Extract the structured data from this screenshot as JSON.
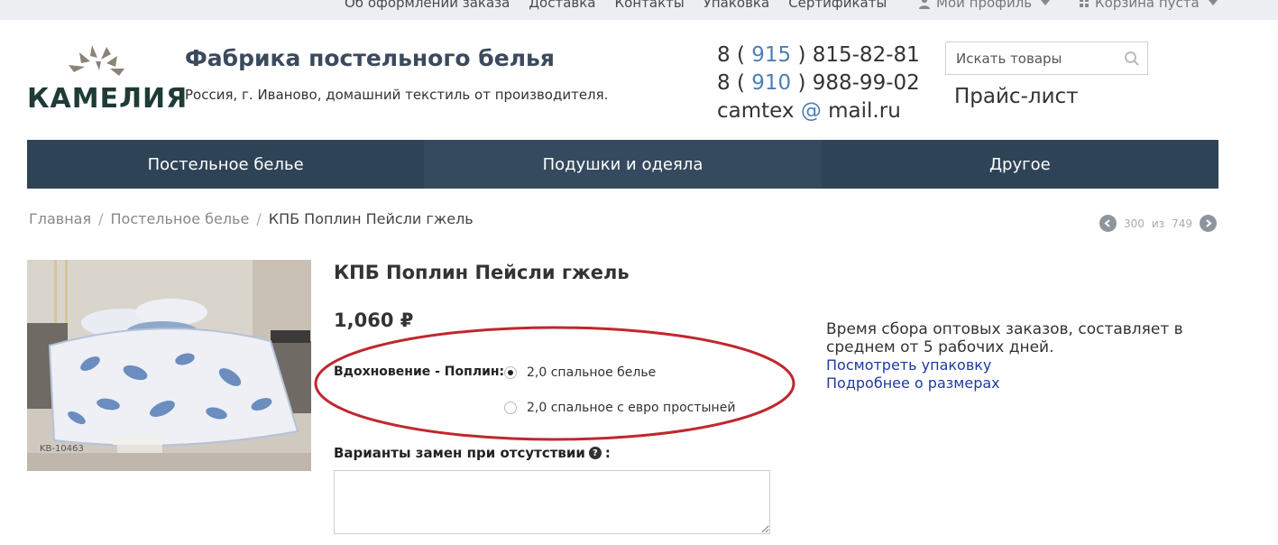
{
  "topbar": {
    "links": [
      "Об оформлении заказа",
      "Доставка",
      "Контакты",
      "Упаковка",
      "Сертификаты"
    ],
    "profile": "Мой профиль",
    "cart": "Корзина пуста"
  },
  "header": {
    "logo_text": "КАМЕЛИЯ",
    "title": "Фабрика постельного белья",
    "subtitle": "Россия, г. Иваново, домашний текстиль от производителя.",
    "phone1": {
      "prefix": "8 ( ",
      "code": "915",
      "rest": " ) 815-82-81"
    },
    "phone2": {
      "prefix": "8 ( ",
      "code": "910",
      "rest": " ) 988-99-02"
    },
    "email": {
      "user": "camtex ",
      "at": "@",
      "domain": " mail.ru"
    },
    "search_placeholder": "Искать товары",
    "price_list": "Прайс-лист"
  },
  "nav": [
    "Постельное белье",
    "Подушки и одеяла",
    "Другое"
  ],
  "breadcrumb": {
    "home": "Главная",
    "section": "Постельное белье",
    "current": "КПБ Поплин Пейсли гжель"
  },
  "pager": {
    "current": "300",
    "of": "из",
    "total": "749"
  },
  "product": {
    "title": "КПБ Поплин Пейсли гжель",
    "price": "1,060 ₽",
    "image_caption": "KB-10463",
    "option_label": "Вдохновение - Поплин:",
    "options": [
      {
        "label": "2,0 спальное белье",
        "selected": true
      },
      {
        "label": "2,0 спальное с евро простыней",
        "selected": false
      }
    ],
    "substitute_label": "Варианты замен при отсутствии",
    "substitute_suffix": ":",
    "substitute_value": ""
  },
  "info": {
    "text": "Время сбора оптовых заказов, составляет в среднем от 5 рабочих дней.",
    "link1": "Посмотреть упаковку",
    "link2": "Подробнее о размерах"
  },
  "colors": {
    "nav_bg": "#2f4357",
    "link": "#1e3aa0",
    "phone_accent": "#4d7fb3",
    "annotation": "#c0272d"
  },
  "icons": [
    "user-icon",
    "cart-icon",
    "search-icon",
    "chevron-left-icon",
    "chevron-right-icon",
    "question-icon"
  ]
}
